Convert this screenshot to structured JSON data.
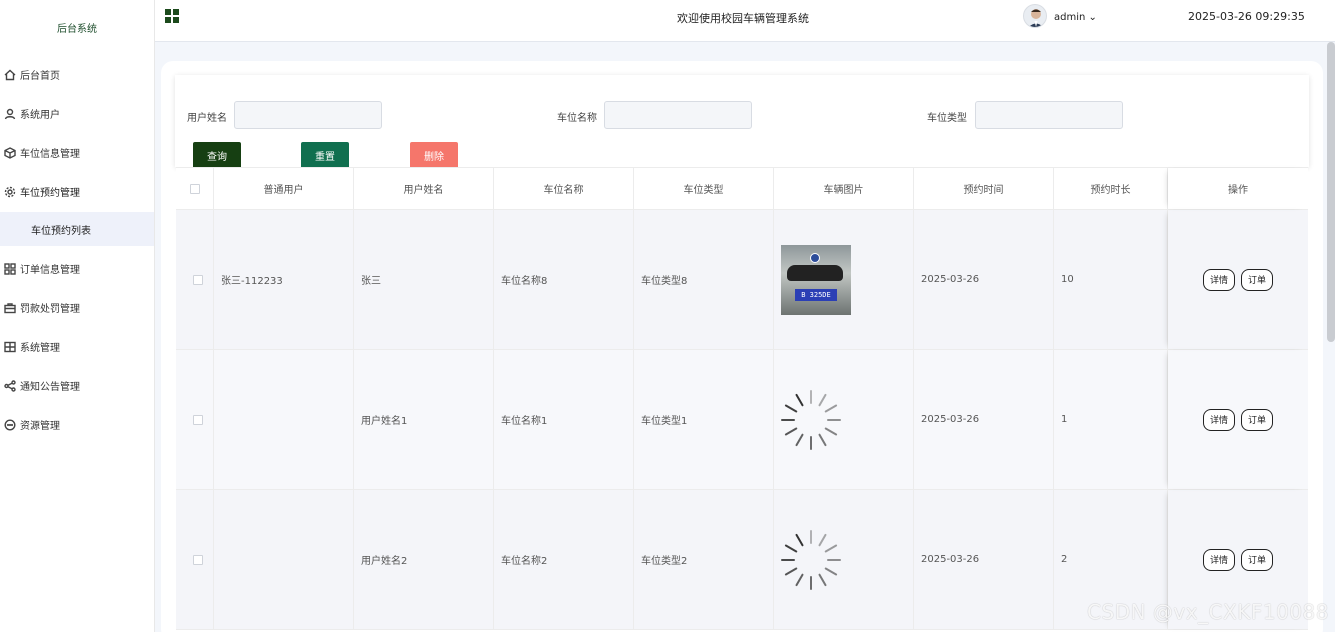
{
  "sidebar": {
    "brand": "后台系统",
    "items": [
      {
        "label": "后台首页",
        "icon": "home-icon"
      },
      {
        "label": "系统用户",
        "icon": "user-icon"
      },
      {
        "label": "车位信息管理",
        "icon": "cube-icon"
      },
      {
        "label": "车位预约管理",
        "icon": "gear-icon"
      },
      {
        "label": "订单信息管理",
        "icon": "grid-icon"
      },
      {
        "label": "罚款处罚管理",
        "icon": "briefcase-icon"
      },
      {
        "label": "系统管理",
        "icon": "layout-icon"
      },
      {
        "label": "通知公告管理",
        "icon": "share-icon"
      },
      {
        "label": "资源管理",
        "icon": "chat-icon"
      }
    ],
    "submenu": {
      "label": "车位预约列表"
    }
  },
  "header": {
    "welcome": "欢迎使用校园车辆管理系统",
    "user": "admin",
    "datetime": "2025-03-26 09:29:35"
  },
  "search": {
    "fields": [
      {
        "label": "用户姓名",
        "value": ""
      },
      {
        "label": "车位名称",
        "value": ""
      },
      {
        "label": "车位类型",
        "value": ""
      }
    ],
    "buttons": {
      "query": "查询",
      "reset": "重置",
      "delete": "删除"
    }
  },
  "table": {
    "columns": [
      "普通用户",
      "用户姓名",
      "车位名称",
      "车位类型",
      "车辆图片",
      "预约时间",
      "预约时长",
      "操作"
    ],
    "rows": [
      {
        "user": "张三-112233",
        "name": "张三",
        "space": "车位名称8",
        "type": "车位类型8",
        "image": "car",
        "plate": "B 325DE",
        "time": "2025-03-26",
        "duration": "10"
      },
      {
        "user": "",
        "name": "用户姓名1",
        "space": "车位名称1",
        "type": "车位类型1",
        "image": "loading",
        "time": "2025-03-26",
        "duration": "1"
      },
      {
        "user": "",
        "name": "用户姓名2",
        "space": "车位名称2",
        "type": "车位类型2",
        "image": "loading",
        "time": "2025-03-26",
        "duration": "2"
      }
    ],
    "actions": {
      "detail": "详情",
      "order": "订单"
    }
  },
  "watermark": "CSDN @vx_CXKF10088"
}
